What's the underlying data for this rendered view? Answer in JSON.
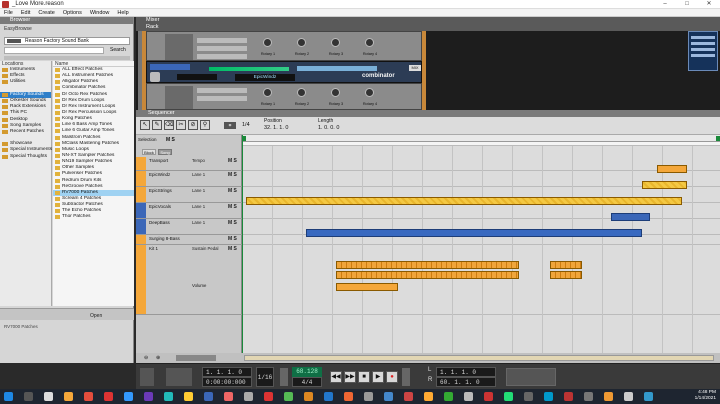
{
  "window": {
    "title": "_Love More.reason",
    "controls": [
      "–",
      "□",
      "✕"
    ]
  },
  "menu": [
    "File",
    "Edit",
    "Create",
    "Options",
    "Window",
    "Help"
  ],
  "browser": {
    "title": "Browser",
    "easybrowse": "EasyBrowse",
    "bank": "Reason Factory Sound Bank",
    "search_label": "Search",
    "locations_header": "Locations",
    "locations": [
      {
        "label": "Instruments",
        "sel": false
      },
      {
        "label": "Effects",
        "sel": false
      },
      {
        "label": "Utilities",
        "sel": false
      },
      {
        "label": "",
        "sel": false
      },
      {
        "label": "Factory Sounds",
        "sel": true
      },
      {
        "label": "Orkester Sounds",
        "sel": false
      },
      {
        "label": "Rack Extensions",
        "sel": false
      },
      {
        "label": "This PC",
        "sel": false
      },
      {
        "label": "Desktop",
        "sel": false
      },
      {
        "label": "Song Samples",
        "sel": false
      },
      {
        "label": "Recent Patches",
        "sel": false
      },
      {
        "label": "",
        "sel": false
      },
      {
        "label": "Showcase",
        "sel": false
      },
      {
        "label": "Special Instruments",
        "sel": false
      },
      {
        "label": "Special Thoughts",
        "sel": false
      }
    ],
    "files_header": "Name",
    "files": [
      {
        "label": "ALL Effect Patches",
        "sel": false
      },
      {
        "label": "ALL Instrument Patches",
        "sel": false
      },
      {
        "label": "Alligator Patches",
        "sel": false
      },
      {
        "label": "Combinator Patches",
        "sel": false
      },
      {
        "label": "Dr Octo Rex Patches",
        "sel": false
      },
      {
        "label": "Dr Rex Drum Loops",
        "sel": false
      },
      {
        "label": "Dr Rex Instrument Loops",
        "sel": false
      },
      {
        "label": "Dr Rex Percussion Loops",
        "sel": false
      },
      {
        "label": "Kong Patches",
        "sel": false
      },
      {
        "label": "Line 6 Bass Amp Tones",
        "sel": false
      },
      {
        "label": "Line 6 Guitar Amp Tones",
        "sel": false
      },
      {
        "label": "Malstrom Patches",
        "sel": false
      },
      {
        "label": "MClass Mastering Patches",
        "sel": false
      },
      {
        "label": "Music Loops",
        "sel": false
      },
      {
        "label": "NN-XT Sampler Patches",
        "sel": false
      },
      {
        "label": "NN19 Sampler Patches",
        "sel": false
      },
      {
        "label": "Other Samples",
        "sel": false
      },
      {
        "label": "Pulveriser Patches",
        "sel": false
      },
      {
        "label": "Redrum Drum Kits",
        "sel": false
      },
      {
        "label": "ReGroove Patches",
        "sel": false
      },
      {
        "label": "RV7000 Patches",
        "sel": true
      },
      {
        "label": "Scream 4 Patches",
        "sel": false
      },
      {
        "label": "Subtractor Patches",
        "sel": false
      },
      {
        "label": "The Echo Patches",
        "sel": false
      },
      {
        "label": "Thor Patches",
        "sel": false
      }
    ],
    "open_label": "Open",
    "status": "RV7000 Patches"
  },
  "rack": {
    "mixer_label": "Mixer",
    "rack_label": "Rack",
    "combinator_label": "combinator",
    "patch_name": "EpicWindz",
    "knob_labels": [
      "Rotary 1",
      "Rotary 2",
      "Rotary 3",
      "Rotary 4"
    ]
  },
  "sequencer": {
    "title": "Sequencer",
    "snap": "1/4",
    "position_label": "Position",
    "position_value": "32. 1. 1. 0",
    "length_label": "Length",
    "length_value": "1. 0. 0. 0",
    "edit_label": "Edit",
    "block_label": "Block",
    "song_label": "Song",
    "ms": "M S",
    "lanes": [
      {
        "name": "Transport",
        "sub": "Tempo",
        "color": "#f4a73a"
      },
      {
        "name": "EpicWindz",
        "sub": "Lane 1",
        "color": "#f4a73a"
      },
      {
        "name": "EpicStrings",
        "sub": "Lane 1",
        "color": "#f4a73a"
      },
      {
        "name": "EpicVocals",
        "sub": "Lane 1",
        "color": "#3b67b8"
      },
      {
        "name": "DeepBass",
        "sub": "Lane 1",
        "color": "#3b67b8"
      },
      {
        "name": "Surging 8-Bass",
        "sub": "",
        "color": "#f4a73a"
      },
      {
        "name": "Kit 1",
        "sub": "Sustain Pedal",
        "color": "#f4a73a"
      }
    ],
    "volume_label": "Volume"
  },
  "transport": {
    "position": "1. 1. 1. 0",
    "time": "0:00:00:000",
    "quantize": "1/16",
    "tempo": "68.128",
    "signature": "4/4",
    "loop_l": "1. 1. 1. 0",
    "loop_r": "60. 1. 1. 0",
    "l_label": "L",
    "r_label": "R",
    "buttons": [
      "◀◀",
      "▶▶",
      "■",
      "▶",
      "●"
    ]
  },
  "taskbar": {
    "time": "4:48 PM",
    "date": "1/14/2021"
  }
}
